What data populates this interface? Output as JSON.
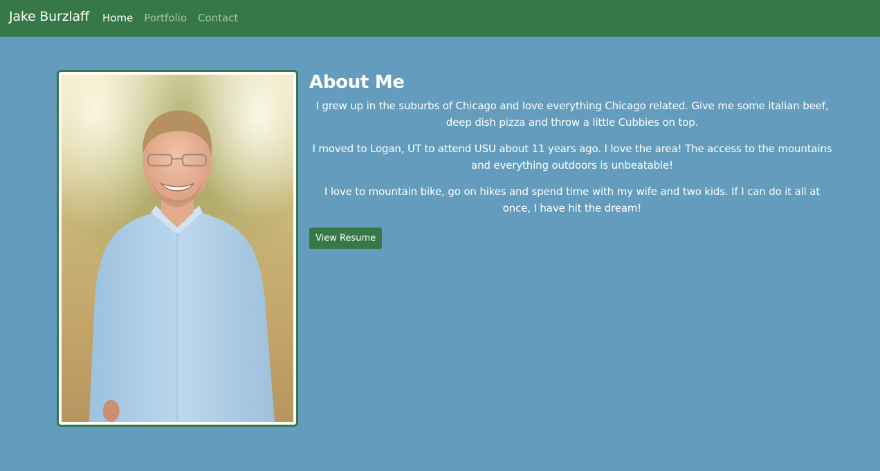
{
  "nav": {
    "brand": "Jake Burzlaff",
    "links": [
      {
        "label": "Home",
        "active": true
      },
      {
        "label": "Portfolio",
        "active": false
      },
      {
        "label": "Contact",
        "active": false
      }
    ]
  },
  "profile_photo": {
    "icon": "profile-photo"
  },
  "about": {
    "heading": "About Me",
    "paragraphs": [
      "I grew up in the suburbs of Chicago and love everything Chicago related. Give me some italian beef, deep dish pizza and throw a little Cubbies on top.",
      "I moved to Logan, UT to attend USU about 11 years ago. I love the area! The access to the mountains and everything outdoors is unbeatable!",
      "I love to mountain bike, go on hikes and spend time with my wife and two kids. If I can do it all at once, I have hit the dream!"
    ],
    "button_label": "View Resume"
  },
  "colors": {
    "navbar": "#367848",
    "background": "#639cbc",
    "accent": "#367848"
  }
}
